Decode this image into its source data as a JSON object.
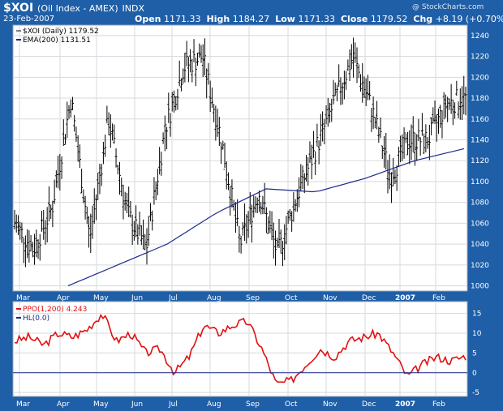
{
  "header": {
    "symbol": "$XOI",
    "name": "(Oil Index - AMEX)",
    "exchange": "INDX",
    "watermark": "@ StockCharts.com",
    "date": "23-Feb-2007",
    "open_label": "Open",
    "open": "1171.33",
    "high_label": "High",
    "high": "1184.27",
    "low_label": "Low",
    "low": "1171.33",
    "close_label": "Close",
    "close": "1179.52",
    "chg_label": "Chg",
    "chg": "+8.19 (+0.70%)"
  },
  "legend": {
    "price": "$XOI (Daily) 1179.52",
    "ema": "EMA(200) 1131.51",
    "ppo": "PPO(1,200) 4.243",
    "hl": "HL(0.0)"
  },
  "colors": {
    "background": "#1f5fa8",
    "price_bars": "#000000",
    "ema": "#1c2a8c",
    "ppo": "#e01010",
    "zero_line": "#1c2a8c"
  },
  "chart_data": [
    {
      "type": "ohlc",
      "title": "$XOI (Daily)",
      "ylim": [
        995,
        1250
      ],
      "y_ticks": [
        1000,
        1020,
        1040,
        1060,
        1080,
        1100,
        1120,
        1140,
        1160,
        1180,
        1200,
        1220,
        1240
      ],
      "x_ticks": [
        "Mar",
        "Apr",
        "May",
        "Jun",
        "Jul",
        "Aug",
        "Sep",
        "Oct",
        "Nov",
        "Dec",
        "2007",
        "Feb"
      ],
      "price_anchors": [
        1060,
        1035,
        1075,
        1180,
        1045,
        1160,
        1070,
        1035,
        1150,
        1210,
        1220,
        1140,
        1040,
        1090,
        1030,
        1085,
        1130,
        1175,
        1220,
        1170,
        1105,
        1140,
        1140,
        1175,
        1180
      ],
      "series": [
        {
          "name": "EMA(200)",
          "type": "line",
          "values": [
            1000,
            1020,
            1040,
            1070,
            1093,
            1090,
            1103,
            1120,
            1131.51
          ]
        }
      ]
    },
    {
      "type": "line",
      "title": "PPO(1,200)",
      "ylim": [
        -6,
        18
      ],
      "y_ticks": [
        -5,
        0,
        5,
        10,
        15
      ],
      "x_ticks": [
        "Mar",
        "Apr",
        "May",
        "Jun",
        "Jul",
        "Aug",
        "Sep",
        "Oct",
        "Nov",
        "Dec",
        "2007",
        "Feb"
      ],
      "series": [
        {
          "name": "PPO(1,200)",
          "values": [
            8,
            9,
            7,
            10,
            9,
            11,
            15,
            8,
            10,
            5,
            6,
            0,
            4,
            12,
            10,
            12,
            13,
            6,
            -3,
            -2,
            2,
            6,
            4,
            8,
            9,
            10,
            5,
            -1,
            2,
            4,
            3,
            4.243
          ]
        },
        {
          "name": "HL(0.0)",
          "values": [
            0,
            0
          ]
        }
      ]
    }
  ]
}
